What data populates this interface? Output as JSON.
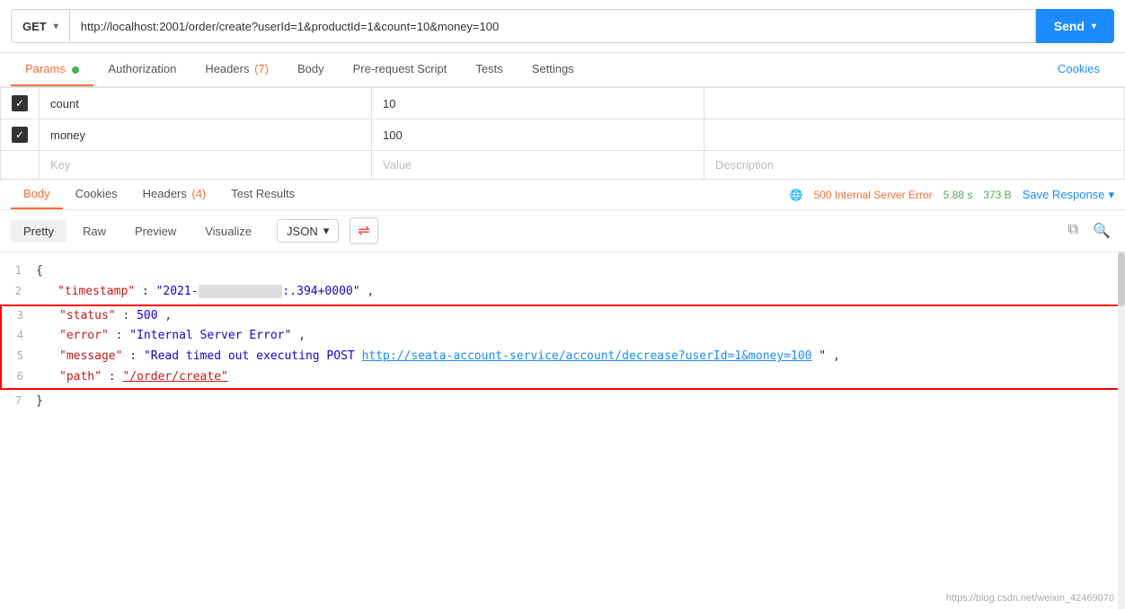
{
  "url_bar": {
    "method": "GET",
    "method_chevron": "▾",
    "url": "http://localhost:2001/order/create?userId=1&productId=1&count=10&money=100",
    "send_label": "Send",
    "send_chevron": "▾"
  },
  "request_tabs": {
    "params_label": "Params",
    "authorization_label": "Authorization",
    "headers_label": "Headers",
    "headers_count": "(7)",
    "body_label": "Body",
    "prerequest_label": "Pre-request Script",
    "tests_label": "Tests",
    "settings_label": "Settings",
    "cookies_label": "Cookies"
  },
  "params_rows": [
    {
      "key": "count",
      "value": "10",
      "checked": true
    },
    {
      "key": "money",
      "value": "100",
      "checked": true
    }
  ],
  "params_placeholder": {
    "key": "Key",
    "value": "Value",
    "description": "Description"
  },
  "response_tabs": {
    "body_label": "Body",
    "cookies_label": "Cookies",
    "headers_label": "Headers",
    "headers_count": "(4)",
    "test_results_label": "Test Results"
  },
  "response_meta": {
    "status": "500 Internal Server Error",
    "time": "5.88 s",
    "size": "373 B",
    "save_response_label": "Save Response",
    "save_chevron": "▾"
  },
  "format_row": {
    "pretty_label": "Pretty",
    "raw_label": "Raw",
    "preview_label": "Preview",
    "visualize_label": "Visualize",
    "format_type": "JSON",
    "format_chevron": "▾"
  },
  "json_content": {
    "line1": "{",
    "line2_key": "\"timestamp\"",
    "line2_value": "\"2021-",
    "line2_redacted": "            ",
    "line2_end": ":.394+0000\",",
    "line3_key": "\"status\"",
    "line3_value": "500,",
    "line4_key": "\"error\"",
    "line4_value": "\"Internal Server Error\",",
    "line5_key": "\"message\"",
    "line5_pre": ": \"Read timed out executing POST ",
    "line5_url": "http://seata-account-service/account/decrease?userId=1&money=100",
    "line5_end": "\",",
    "line6_key": "\"path\"",
    "line6_path": "\"/order/create\"",
    "line7": "}"
  },
  "watermark": "https://blog.csdn.net/weixin_42469070"
}
